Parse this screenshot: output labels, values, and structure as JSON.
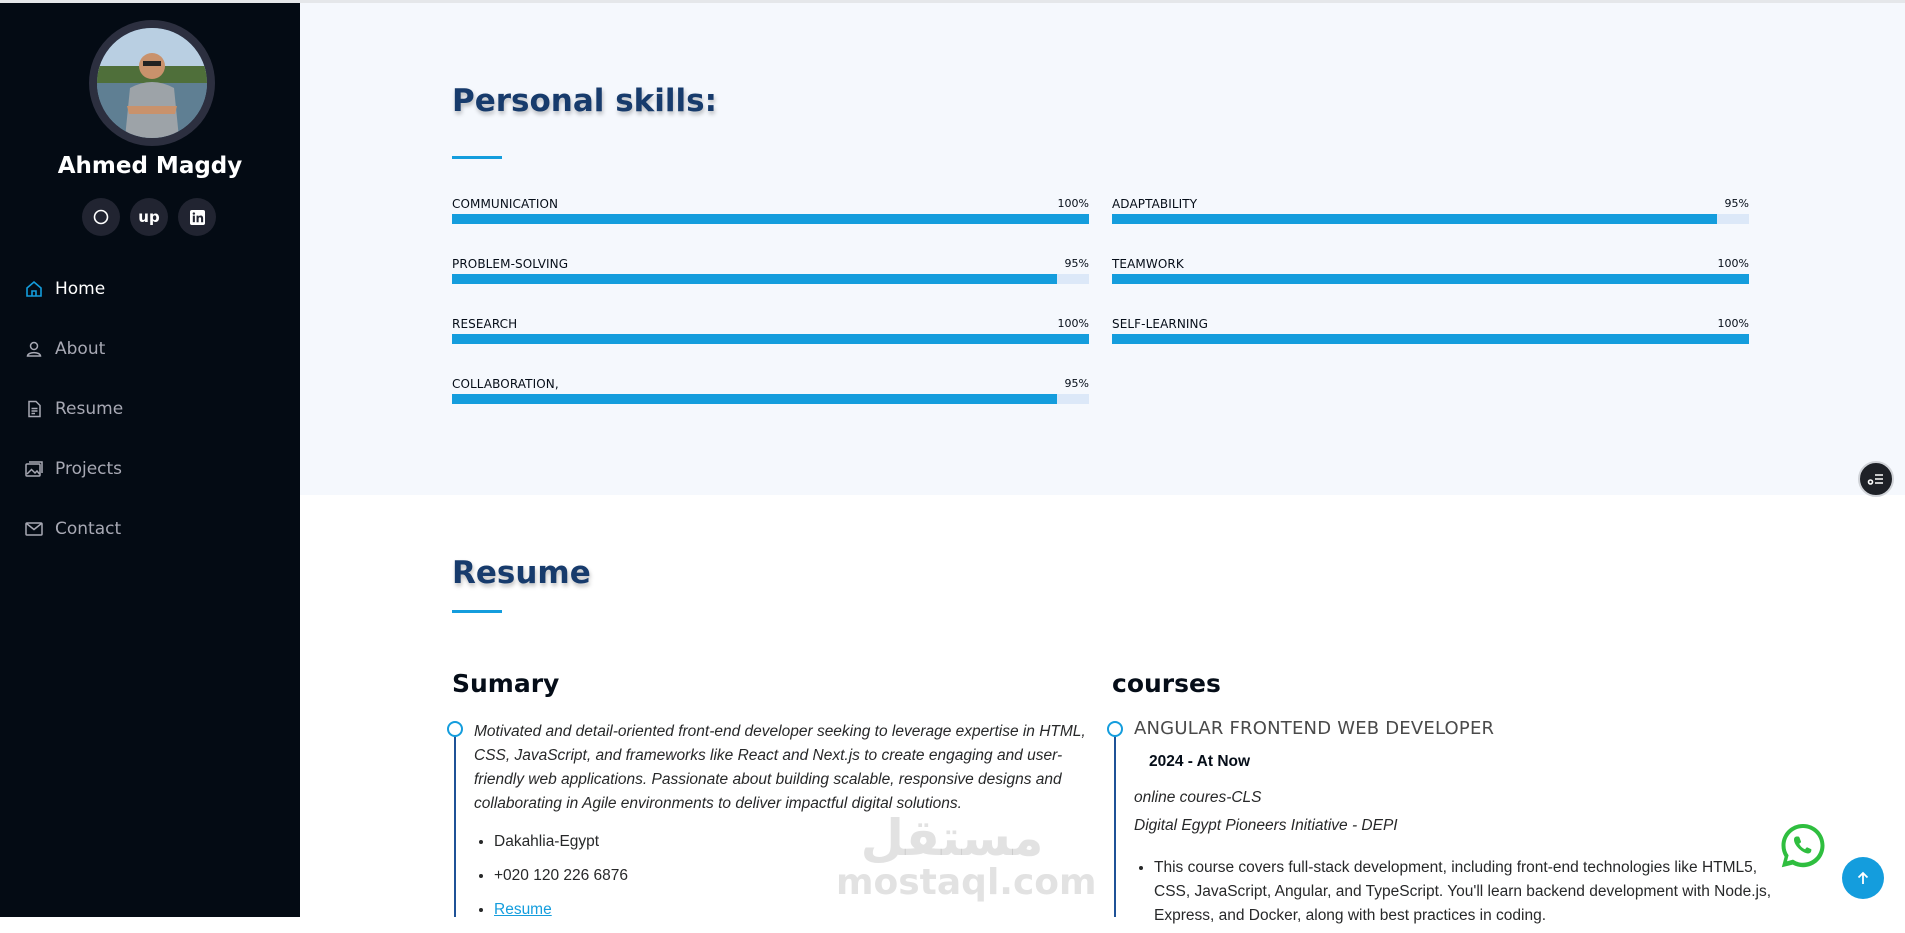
{
  "profile": {
    "name": "Ahmed Magdy",
    "social": [
      {
        "icon": "circle-icon",
        "label": ""
      },
      {
        "icon": "upwork-icon",
        "label": "up"
      },
      {
        "icon": "linkedin-icon",
        "label": ""
      }
    ]
  },
  "nav": [
    {
      "label": "Home",
      "icon": "home-icon",
      "active": true
    },
    {
      "label": "About",
      "icon": "person-icon",
      "active": false
    },
    {
      "label": "Resume",
      "icon": "file-icon",
      "active": false
    },
    {
      "label": "Projects",
      "icon": "images-icon",
      "active": false
    },
    {
      "label": "Contact",
      "icon": "envelope-icon",
      "active": false
    }
  ],
  "skills": {
    "title": "Personal skills:",
    "items": [
      {
        "name": "COMMUNICATION",
        "value": "100%",
        "percent": 100
      },
      {
        "name": "ADAPTABILITY",
        "value": "95%",
        "percent": 95
      },
      {
        "name": "PROBLEM-SOLVING",
        "value": "95%",
        "percent": 95
      },
      {
        "name": "TEAMWORK",
        "value": "100%",
        "percent": 100
      },
      {
        "name": "RESEARCH",
        "value": "100%",
        "percent": 100
      },
      {
        "name": "SELF-LEARNING",
        "value": "100%",
        "percent": 100
      },
      {
        "name": "COLLABORATION,",
        "value": "95%",
        "percent": 95
      }
    ]
  },
  "resume": {
    "title": "Resume",
    "summary": {
      "heading": "Sumary",
      "text": "Motivated and detail-oriented front-end developer seeking to leverage expertise in HTML, CSS, JavaScript, and frameworks like React and Next.js to create engaging and user-friendly web applications. Passionate about building scalable, responsive designs and collaborating in Agile environments to deliver impactful digital solutions.",
      "location": "Dakahlia-Egypt",
      "phone": "+020 120 226 6876",
      "resume_link": "Resume"
    },
    "courses": {
      "heading": "courses",
      "title": "ANGULAR FRONTEND WEB DEVELOPER",
      "date": "2024 - At Now",
      "provider": "online coures-CLS",
      "organization": "Digital Egypt Pioneers Initiative - DEPI",
      "description": "This course covers full-stack development, including front-end technologies like HTML5, CSS, JavaScript, Angular, and TypeScript. You'll learn backend development with Node.js, Express, and Docker, along with best practices in coding."
    }
  },
  "watermark": {
    "arabic": "مستقل",
    "latin": "mostaql.com"
  },
  "colors": {
    "accent": "#149ddd",
    "sidebar": "#040b14",
    "section_bg": "#f5f8fd"
  }
}
